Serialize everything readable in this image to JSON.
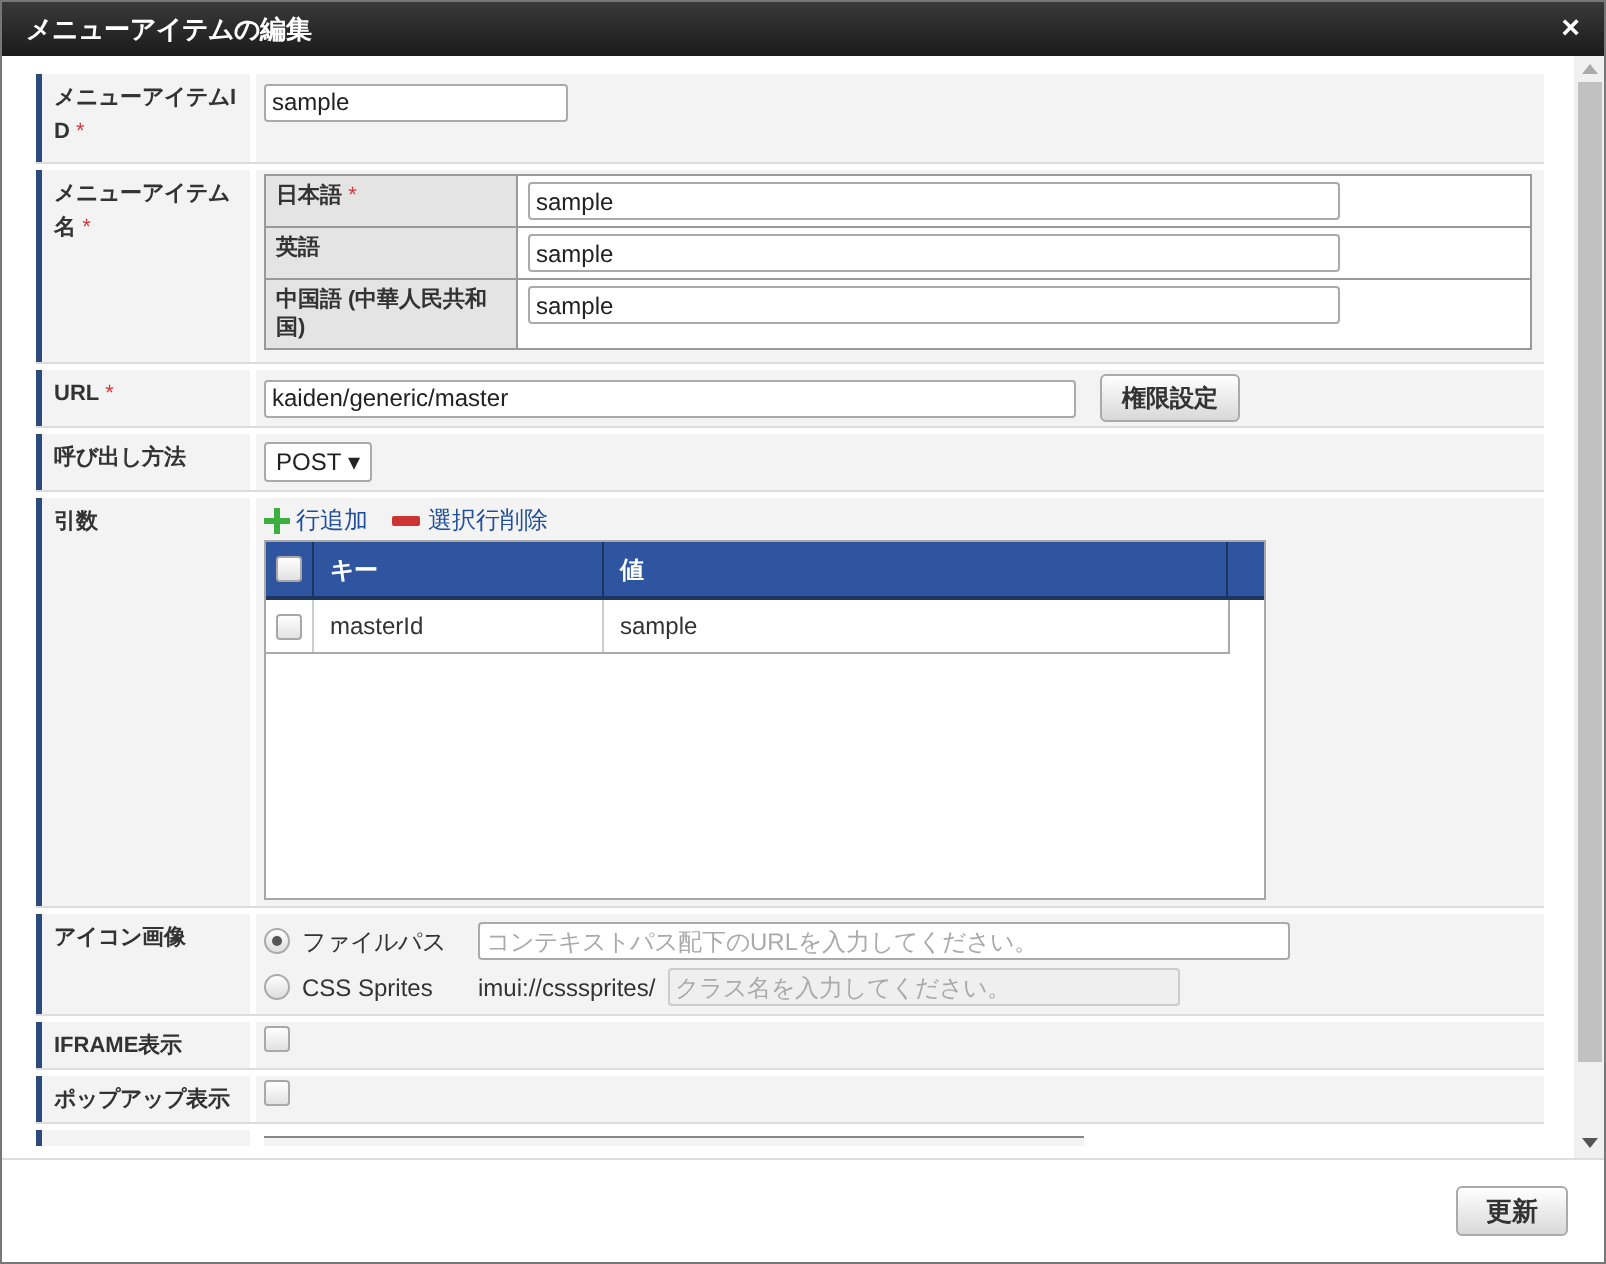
{
  "window": {
    "title": "メニューアイテムの編集",
    "close": "×"
  },
  "fields": [
    {
      "kind": "text",
      "label": "メニューアイテムID",
      "required_mark": "*",
      "value": "sample"
    },
    {
      "kind": "locales",
      "label": "メニューアイテム名",
      "required_mark": "*",
      "locales": [
        {
          "language": "日本語",
          "required_mark": "*",
          "value": "sample"
        },
        {
          "language": "英語",
          "value": "sample"
        },
        {
          "language": "中国語 (中華人民共和国)",
          "value": "sample"
        }
      ]
    },
    {
      "kind": "url",
      "label": "URL",
      "required_mark": "*",
      "value": "kaiden/generic/master",
      "button": "権限設定"
    },
    {
      "kind": "select",
      "label": "呼び出し方法",
      "value": "POST ▾"
    },
    {
      "kind": "grid",
      "label": "引数",
      "add": "行追加",
      "remove": "選択行削除",
      "columns": [
        "キー",
        "値"
      ],
      "header_checked": false,
      "rows": [
        {
          "checked": false,
          "cells": [
            "masterId",
            "sample"
          ]
        }
      ]
    },
    {
      "kind": "icon",
      "label": "アイコン画像",
      "options": [
        {
          "label": "ファイルパス",
          "selected": true,
          "placeholder": "コンテキストパス配下のURLを入力してください。",
          "disabled": false
        },
        {
          "label": "CSS Sprites",
          "prefix": "imui://csssprites/",
          "selected": false,
          "placeholder": "クラス名を入力してください。",
          "disabled": true
        }
      ]
    },
    {
      "kind": "checkbox",
      "label": "IFRAME表示",
      "checked": false
    },
    {
      "kind": "checkbox",
      "label": "ポップアップ表示",
      "checked": false
    }
  ],
  "footer": {
    "button": "更新"
  }
}
